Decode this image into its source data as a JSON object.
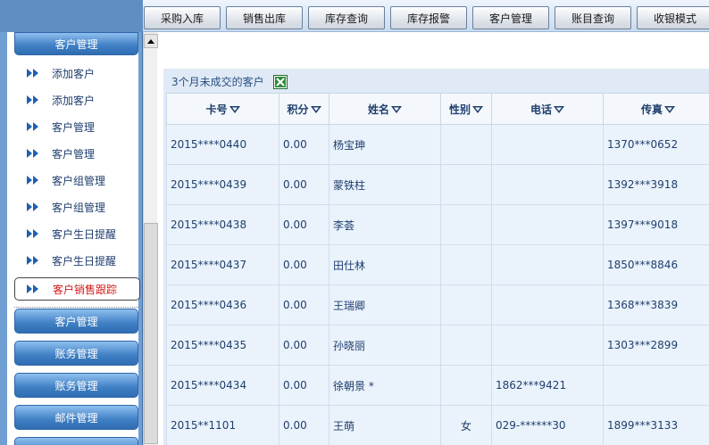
{
  "top_nav": [
    {
      "label": "采购入库"
    },
    {
      "label": "销售出库"
    },
    {
      "label": "库存查询"
    },
    {
      "label": "库存报警"
    },
    {
      "label": "客户管理"
    },
    {
      "label": "账目查询"
    },
    {
      "label": "收银模式"
    }
  ],
  "sidebar": {
    "header_top": "客户管理",
    "items": [
      {
        "label": "添加客户"
      },
      {
        "label": "添加客户"
      },
      {
        "label": "客户管理"
      },
      {
        "label": "客户管理"
      },
      {
        "label": "客户组管理"
      },
      {
        "label": "客户组管理"
      },
      {
        "label": "客户生日提醒"
      },
      {
        "label": "客户生日提醒"
      },
      {
        "label": "客户销售跟踪"
      }
    ],
    "sections": [
      {
        "label": "客户管理"
      },
      {
        "label": "账务管理"
      },
      {
        "label": "账务管理"
      },
      {
        "label": "邮件管理"
      }
    ]
  },
  "panel": {
    "title": "3个月未成交的客户",
    "export_icon": "excel-icon"
  },
  "table": {
    "headers": [
      "卡号",
      "积分",
      "姓名",
      "性别",
      "电话",
      "传真"
    ],
    "rows": [
      [
        "2015****0440",
        "0.00",
        "杨宝珅",
        "",
        "",
        "1370***0652"
      ],
      [
        "2015****0439",
        "0.00",
        "蒙铁柱",
        "",
        "",
        "1392***3918"
      ],
      [
        "2015****0438",
        "0.00",
        "李荟",
        "",
        "",
        "1397***9018"
      ],
      [
        "2015****0437",
        "0.00",
        "田仕林",
        "",
        "",
        "1850***8846"
      ],
      [
        "2015****0436",
        "0.00",
        "王瑞卿",
        "",
        "",
        "1368***3839"
      ],
      [
        "2015****0435",
        "0.00",
        "孙晓丽",
        "",
        "",
        "1303***2899"
      ],
      [
        "2015****0434",
        "0.00",
        "徐朝景 *",
        "",
        "1862***9421",
        ""
      ],
      [
        "2015**1101",
        "0.00",
        "王萌",
        "女",
        "029-******30",
        "1899***3133"
      ]
    ]
  },
  "colors": {
    "sidebar_bg": "#6f9fd3",
    "accent_text": "#1f3e6e",
    "active_text": "#d01a1a",
    "header_button": "#3f7fc4"
  }
}
